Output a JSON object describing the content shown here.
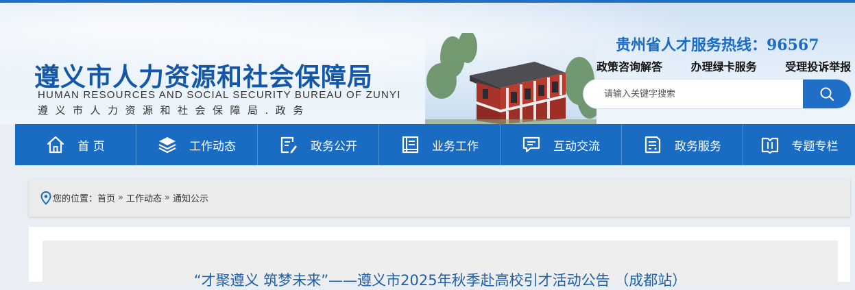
{
  "header": {
    "title_cn": "遵义市人力资源和社会保障局",
    "title_en": "HUMAN RESOURCES AND SOCIAL SECURITY BUREAU OF ZUNYI",
    "title_sub": "遵义市人力资源和社会保障局.政务",
    "hotline": "贵州省人才服务热线：96567",
    "services": [
      "政策咨询解答",
      "办理绿卡服务",
      "受理投诉举报"
    ],
    "search": {
      "placeholder": "请输入关键字搜索",
      "icon": "search-icon"
    }
  },
  "nav": {
    "items": [
      {
        "label": "首 页",
        "icon": "home-icon"
      },
      {
        "label": "工作动态",
        "icon": "layers-icon"
      },
      {
        "label": "政务公开",
        "icon": "document-edit-icon"
      },
      {
        "label": "业务工作",
        "icon": "file-list-icon"
      },
      {
        "label": "互动交流",
        "icon": "chat-icon"
      },
      {
        "label": "政务服务",
        "icon": "service-list-icon"
      },
      {
        "label": "专题专栏",
        "icon": "book-icon"
      }
    ]
  },
  "breadcrumb": {
    "prefix": "您的位置：",
    "items": [
      "首页",
      "工作动态",
      "通知公示"
    ],
    "separator": "»"
  },
  "article": {
    "title": "“才聚遵义 筑梦未来”——遵义市2025年秋季赴高校引才活动公告 （成都站）"
  },
  "colors": {
    "primary": "#1a6cc3",
    "title_blue": "#1358a8",
    "article_title": "#1f5fa8"
  }
}
